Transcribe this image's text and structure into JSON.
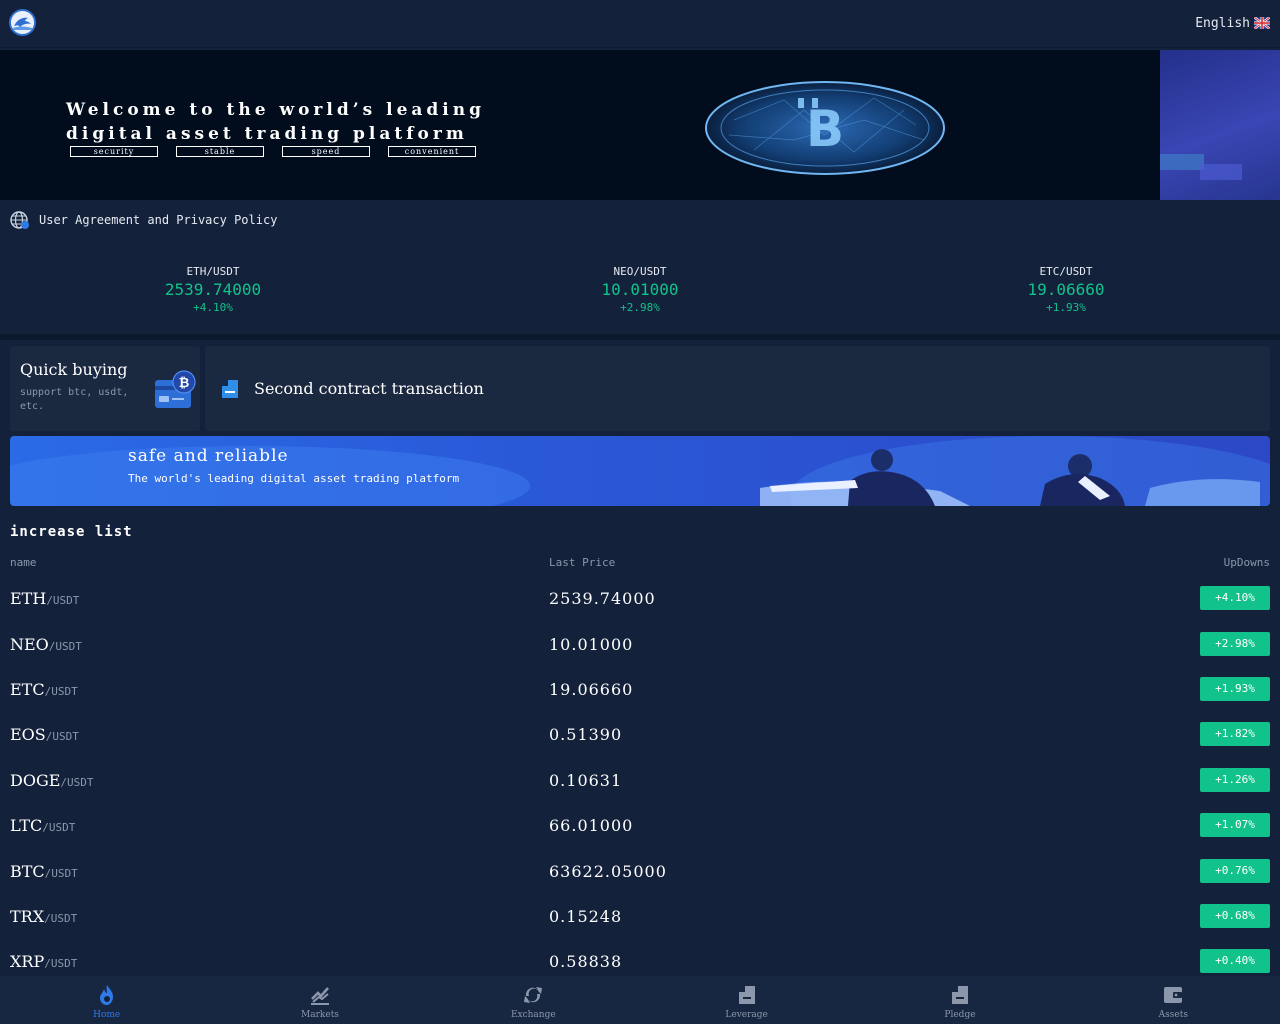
{
  "header": {
    "language": "English",
    "flag_icon": "uk-flag-icon",
    "logo_icon": "dolphin-logo-icon"
  },
  "banner": {
    "title_line1": "Welcome to the world’s leading",
    "title_line2": "digital asset trading platform",
    "tags": [
      "security",
      "stable",
      "speed",
      "convenient"
    ],
    "slide_count": 4,
    "active_slide": 3
  },
  "notice": {
    "icon": "globe-icon",
    "text": "User Agreement and Privacy Policy"
  },
  "tickers": [
    {
      "pair": "ETH/USDT",
      "price": "2539.74000",
      "change": "+4.10%"
    },
    {
      "pair": "NEO/USDT",
      "price": "10.01000",
      "change": "+2.98%"
    },
    {
      "pair": "ETC/USDT",
      "price": "19.06660",
      "change": "+1.93%"
    }
  ],
  "quick_buying": {
    "title": "Quick buying",
    "subtitle": "support btc, usdt, etc.",
    "icon": "card-bitcoin-icon"
  },
  "contract": {
    "icon": "document-icon",
    "label": "Second contract transaction"
  },
  "safe_banner": {
    "title": "safe and reliable",
    "subtitle": "The world's leading digital asset trading platform"
  },
  "increase_list": {
    "title": "increase list",
    "columns": {
      "name": "name",
      "last_price": "Last Price",
      "updowns": "UpDowns"
    },
    "rows": [
      {
        "base": "ETH",
        "quote": "/USDT",
        "price": "2539.74000",
        "change": "+4.10%"
      },
      {
        "base": "NEO",
        "quote": "/USDT",
        "price": "10.01000",
        "change": "+2.98%"
      },
      {
        "base": "ETC",
        "quote": "/USDT",
        "price": "19.06660",
        "change": "+1.93%"
      },
      {
        "base": "EOS",
        "quote": "/USDT",
        "price": "0.51390",
        "change": "+1.82%"
      },
      {
        "base": "DOGE",
        "quote": "/USDT",
        "price": "0.10631",
        "change": "+1.26%"
      },
      {
        "base": "LTC",
        "quote": "/USDT",
        "price": "66.01000",
        "change": "+1.07%"
      },
      {
        "base": "BTC",
        "quote": "/USDT",
        "price": "63622.05000",
        "change": "+0.76%"
      },
      {
        "base": "TRX",
        "quote": "/USDT",
        "price": "0.15248",
        "change": "+0.68%"
      },
      {
        "base": "XRP",
        "quote": "/USDT",
        "price": "0.58838",
        "change": "+0.40%"
      }
    ]
  },
  "nav": {
    "items": [
      {
        "label": "Home",
        "icon": "flame-icon"
      },
      {
        "label": "Markets",
        "icon": "markets-icon"
      },
      {
        "label": "Exchange",
        "icon": "exchange-icon"
      },
      {
        "label": "Leverage",
        "icon": "leverage-icon"
      },
      {
        "label": "Pledge",
        "icon": "pledge-icon"
      },
      {
        "label": "Assets",
        "icon": "wallet-icon"
      }
    ],
    "active": "Home"
  },
  "colors": {
    "background": "#13213a",
    "up_green": "#11c28b",
    "accent_blue": "#2f7ae8",
    "muted_text": "#8c97ab"
  }
}
